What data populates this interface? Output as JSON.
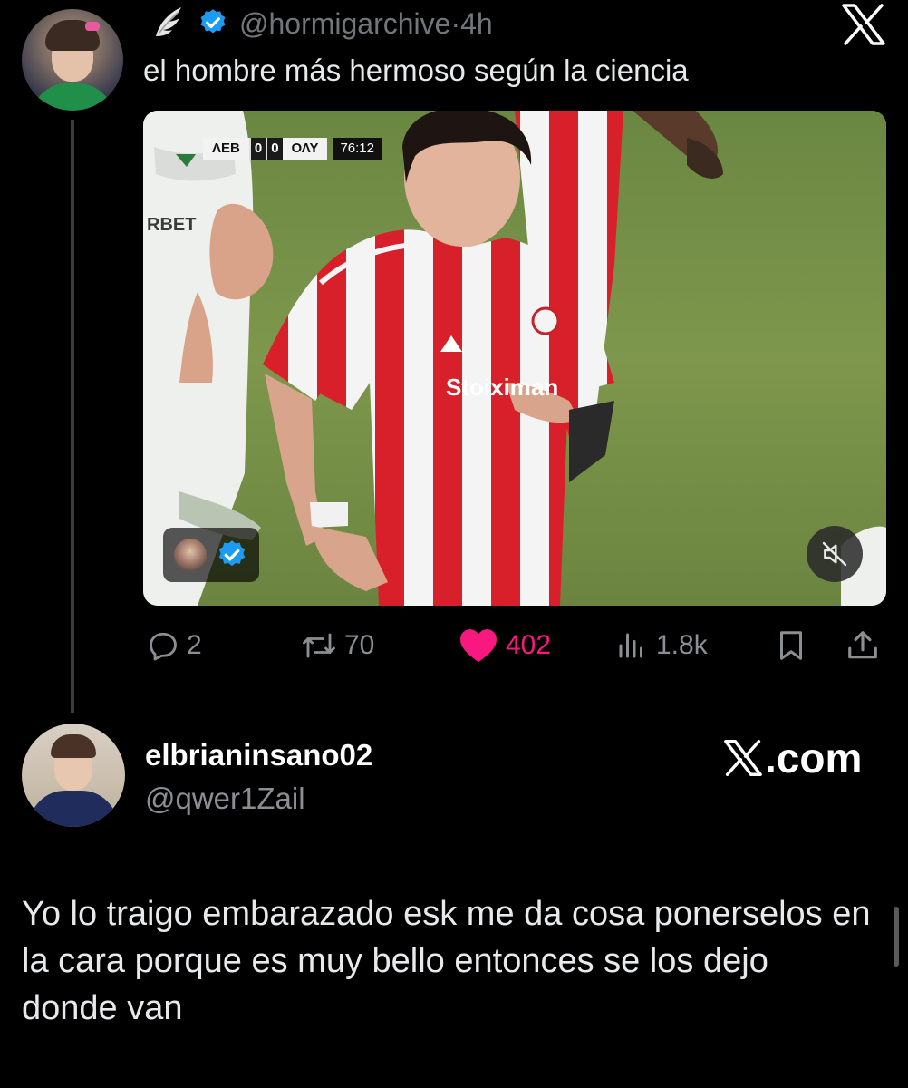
{
  "quoted_tweet": {
    "handle": "@hormigarchive",
    "separator": "·",
    "time": "4h",
    "text": "el hombre más hermoso según la ciencia",
    "media": {
      "scoreboard": {
        "home": "ΛΕΒ",
        "home_score": "0",
        "away_score": "0",
        "away": "ΟΛΥ",
        "clock": "76:12"
      },
      "sponsor": "Stoiximan"
    },
    "actions": {
      "replies": "2",
      "retweets": "70",
      "likes": "402",
      "views": "1.8k"
    }
  },
  "reply_tweet": {
    "display_name": "elbrianinsano02",
    "handle": "@qwer1Zail",
    "source": ".com",
    "text": "Yo lo traigo embarazado esk me da cosa ponerselos en la cara porque es muy bello entonces se los dejo donde van"
  },
  "colors": {
    "background": "#000000",
    "secondary_text": "#71767b",
    "like_accent": "#f91880",
    "verified": "#1d9bf0"
  },
  "icons": [
    "wing-icon",
    "verified-icon",
    "x-logo-icon",
    "reply-icon",
    "retweet-icon",
    "heart-icon",
    "views-icon",
    "bookmark-icon",
    "share-icon",
    "mute-icon"
  ]
}
